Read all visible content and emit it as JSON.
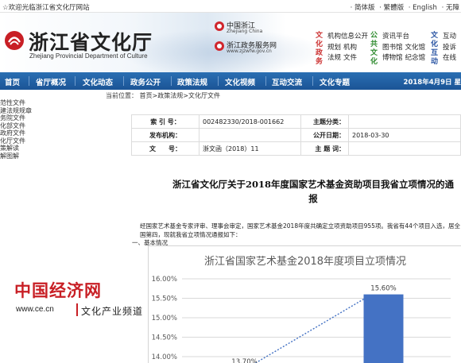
{
  "topbar": {
    "welcome": "☆欢迎光临浙江省文化厅网站",
    "langs": [
      "· 简体版",
      "· 繁體版",
      "· English",
      "· 无障"
    ]
  },
  "header": {
    "title": "浙江省文化厅",
    "subtitle": "Zhejiang Provincial Department of Culture",
    "badge1_main": "中国浙江",
    "badge1_sub": "Zhejiang China",
    "badge2_main": "浙江政务服务网",
    "badge2_sub": "www.zjzwfw.gov.cn",
    "quick1": {
      "vtitle": "文化政务",
      "items": [
        "机构信息公开",
        "规划",
        "机构",
        "法规",
        "文件"
      ]
    },
    "quick2": {
      "vtitle": "公共文化",
      "items": [
        "资讯平台",
        "图书馆",
        "文化馆",
        "博物馆",
        "纪念馆"
      ]
    },
    "quick3": {
      "vtitle": "文化互动",
      "items": [
        "互动",
        "投诉",
        "在线"
      ]
    }
  },
  "nav": {
    "items": [
      "首页",
      "省厅概况",
      "文化动态",
      "政务公开",
      "政策法规",
      "文化视频",
      "互动交流",
      "文化专题"
    ],
    "date": "2018年4月9日 星"
  },
  "breadcrumb": {
    "prefix": "当前位置：",
    "home": "首页",
    "sep1": ">",
    "section": "政策法规",
    "sep2": ">",
    "page": "文化厅文件"
  },
  "sidebar": {
    "items": [
      "范性文件",
      "建法规规章",
      "务院文件",
      "化部文件",
      "政府文件",
      "化厅文件",
      "策解读",
      "解图解"
    ]
  },
  "meta": {
    "index_label": "索 引 号：",
    "index_value": "002482330/2018-001662",
    "category_label": "主题分类：",
    "category_value": "",
    "issuer_label": "发布机构：",
    "issuer_value": "",
    "date_label": "公开日期：",
    "date_value": "2018-03-30",
    "docno_label": "文　　号：",
    "docno_value": "浙文函（2018）11",
    "keywords_label": "主 题 词：",
    "keywords_value": ""
  },
  "doc": {
    "title": "浙江省文化厅关于2018年度国家艺术基金资助项目我省立项情况的通报",
    "para1": "经国家艺术基金专家评审、理事会审定，国家艺术基金2018年度共确定立项资助项目955项。我省有44个项目入选，居全国第四，现就我省立项情况通报如下：",
    "para2": "一、基本情况"
  },
  "chart_data": {
    "type": "bar",
    "title": "浙江省国家艺术基金2018年度项目立项情况",
    "ylim": [
      0.14,
      0.16
    ],
    "yticks": [
      "16.00%",
      "15.50%",
      "15.00%",
      "14.50%",
      "14.00%"
    ],
    "series": [
      {
        "values": [
          0.137,
          0.156
        ]
      }
    ],
    "data_labels": [
      "13.70%",
      "15.60%"
    ],
    "trendline": true,
    "colors": {
      "bar": "#4472c4",
      "trend": "#4472c4",
      "grid": "#d9d9d9",
      "text": "#595959"
    }
  },
  "watermark": {
    "main": "中国经济网",
    "url": "www.ce.cn",
    "sub": "文化产业频道"
  },
  "colors": {
    "nav_bg": "#1b5496",
    "brand_red": "#c81f25"
  }
}
